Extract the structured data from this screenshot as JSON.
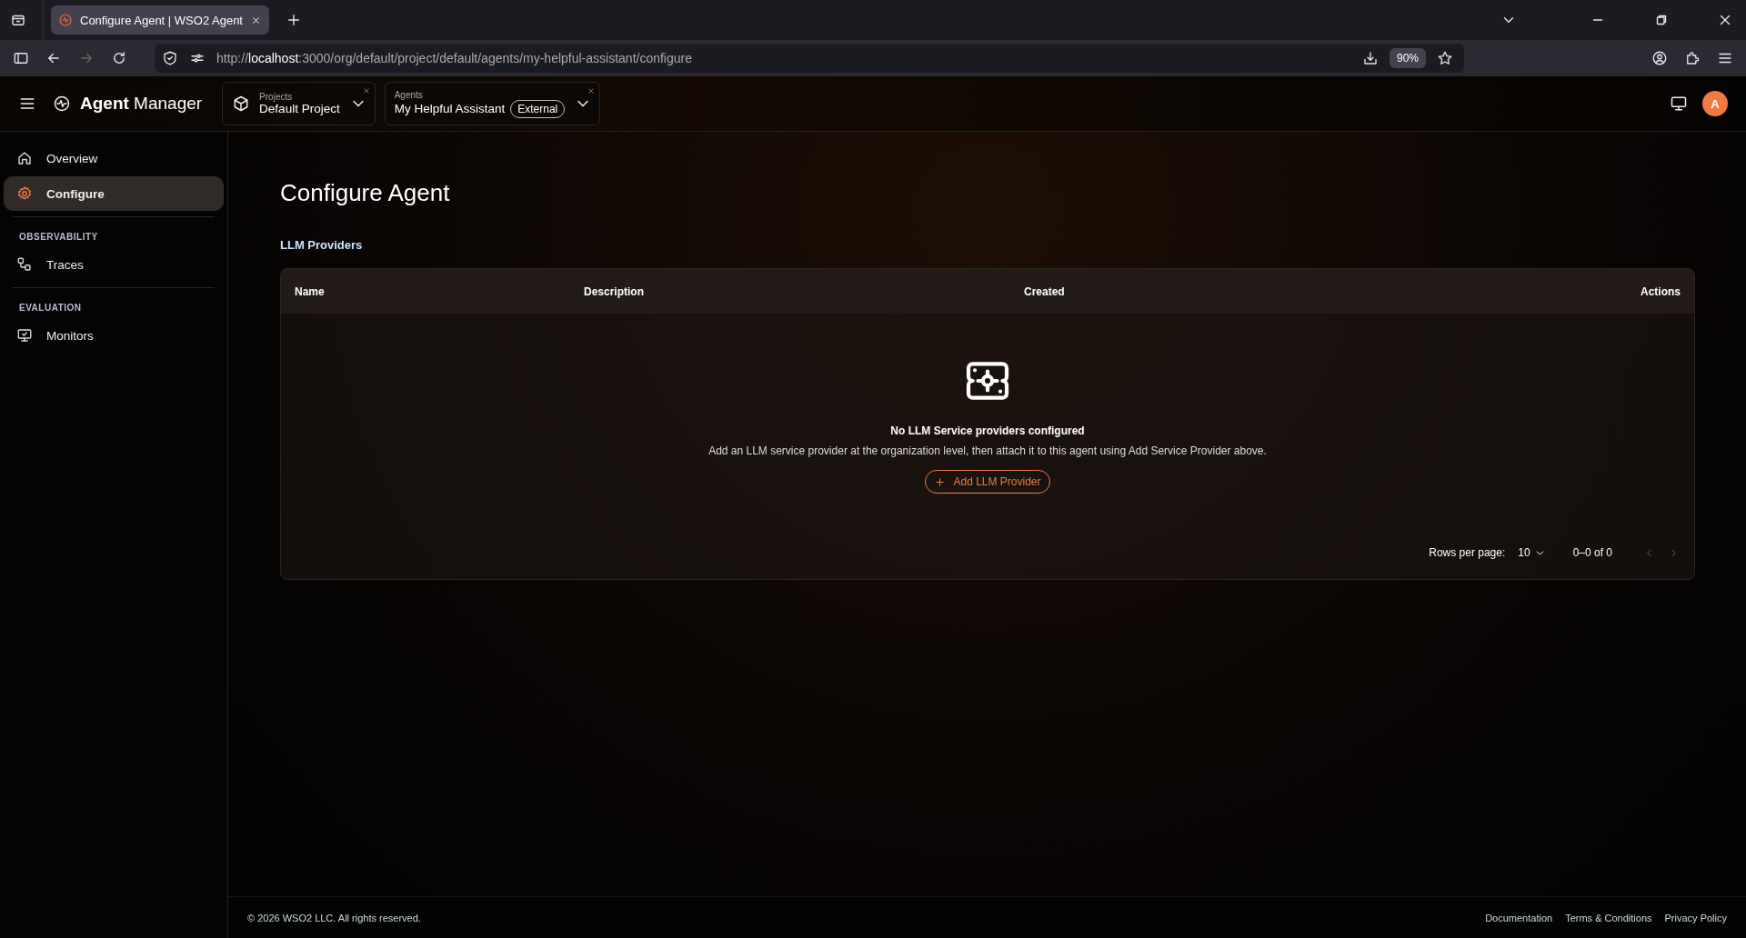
{
  "browser": {
    "tabs": [
      {
        "title": "Configure Agent | WSO2 Agent",
        "selected": true
      }
    ],
    "url_host": "localhost",
    "url_rest": ":3000/org/default/project/default/agents/my-helpful-assistant/configure",
    "url_scheme": "http://",
    "zoom": "90%"
  },
  "header": {
    "app_name_bold": "Agent",
    "app_name_rest": "Manager",
    "selectors": [
      {
        "label": "Projects",
        "value": "Default Project"
      },
      {
        "label": "Agents",
        "value": "My Helpful Assistant",
        "badge": "External"
      }
    ],
    "avatar": "A"
  },
  "sidebar": {
    "sections": [
      {
        "items": [
          {
            "label": "Overview",
            "kind": "home",
            "selected": false
          },
          {
            "label": "Configure",
            "kind": "gear",
            "selected": true
          }
        ]
      },
      {
        "title": "OBSERVABILITY",
        "items": [
          {
            "label": "Traces",
            "kind": "traces",
            "selected": false
          }
        ]
      },
      {
        "title": "EVALUATION",
        "items": [
          {
            "label": "Monitors",
            "kind": "monitor",
            "selected": false
          }
        ]
      }
    ]
  },
  "page": {
    "title": "Configure Agent",
    "section": "LLM Providers",
    "table": {
      "columns": [
        "Name",
        "Description",
        "Created",
        "Actions"
      ],
      "empty": {
        "title": "No LLM Service providers configured",
        "text": "Add an LLM service provider at the organization level, then attach it to this agent using Add Service Provider above.",
        "button": "Add LLM Provider"
      },
      "pagination": {
        "rows_label": "Rows per page:",
        "rows_value": "10",
        "range": "0–0 of 0"
      }
    }
  },
  "footer": {
    "copyright": "© 2026 WSO2 LLC. All rights reserved.",
    "links": [
      "Documentation",
      "Terms & Conditions",
      "Privacy Policy"
    ]
  }
}
